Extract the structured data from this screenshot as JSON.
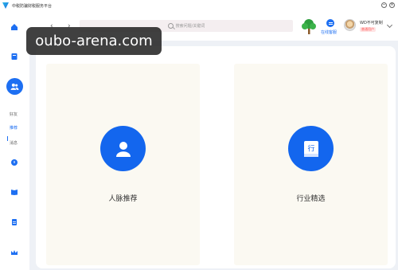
{
  "app": {
    "title": "中税防骗财税服务平台",
    "minimize": "−",
    "close": "×"
  },
  "sidebar": {
    "sub_items": [
      {
        "label": "好友",
        "selected": false
      },
      {
        "label": "推荐",
        "selected": true
      },
      {
        "label": "消息",
        "selected": false
      }
    ],
    "icons": [
      "home-icon",
      "document-icon",
      "contacts-icon",
      "help-icon",
      "book-icon",
      "note-icon",
      "crown-icon"
    ]
  },
  "header": {
    "back": "‹",
    "forward": "›",
    "search": {
      "placeholder": "搜索问题/关键词"
    },
    "service_label": "在线客服",
    "user": {
      "name": "WD不可复制",
      "badge": "普通用户"
    }
  },
  "main": {
    "cards": [
      {
        "label": "人脉推荐",
        "icon": "person-icon"
      },
      {
        "label": "行业精选",
        "icon": "industry-icon",
        "icon_text": "行"
      }
    ]
  },
  "watermark": {
    "text": "oubo-arena.com"
  },
  "colors": {
    "accent": "#1366ee",
    "card_bg": "#fbf9f2",
    "page_bg": "#eef1f6"
  }
}
